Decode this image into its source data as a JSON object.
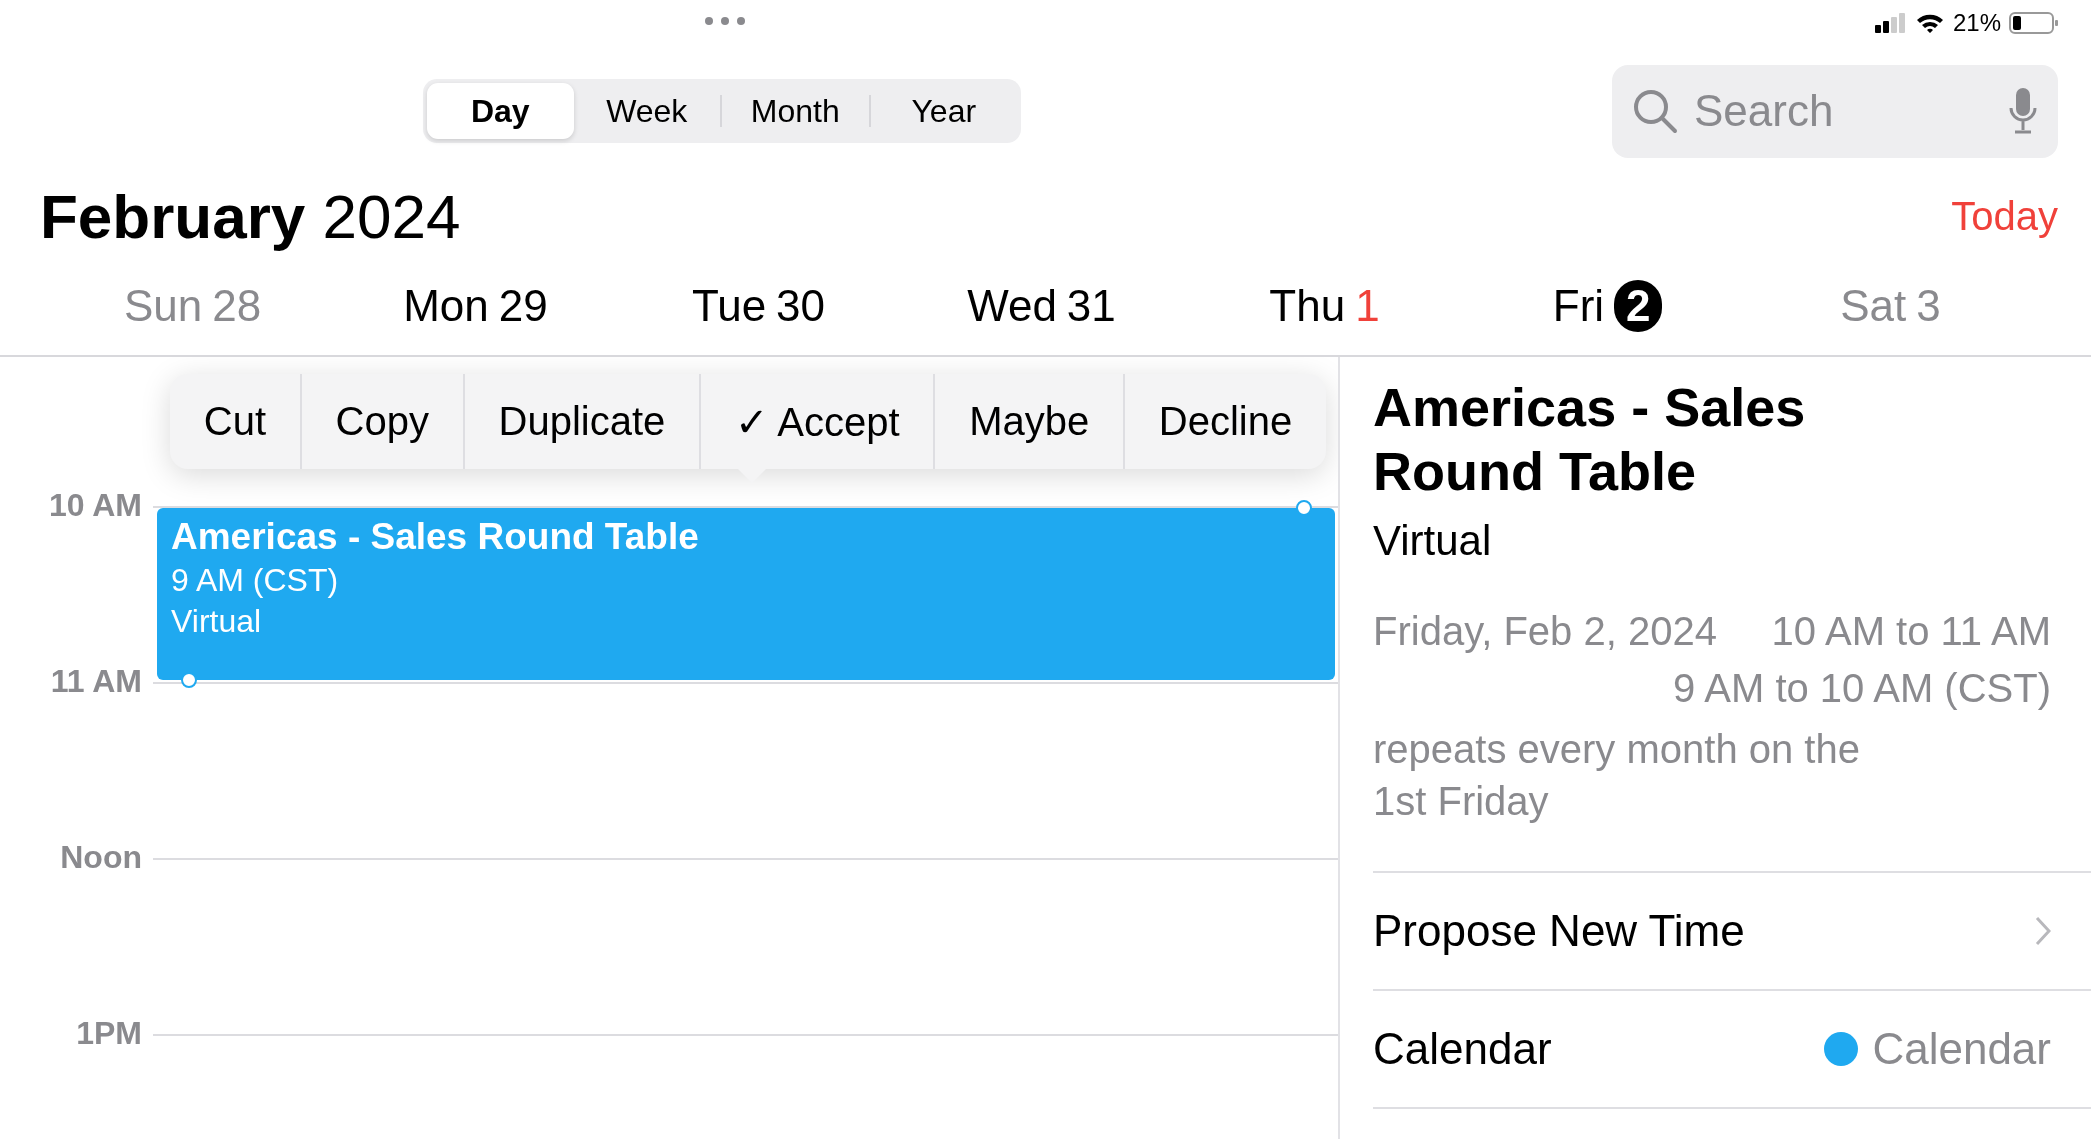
{
  "status_bar": {
    "battery": "21%"
  },
  "view_switcher": [
    {
      "label": "Day",
      "selected": true
    },
    {
      "label": "Week",
      "selected": false
    },
    {
      "label": "Month",
      "selected": false
    },
    {
      "label": "Year",
      "selected": false
    }
  ],
  "search": {
    "placeholder": "Search"
  },
  "header": {
    "month": "February",
    "year": "2024",
    "today_button": "Today"
  },
  "days": [
    {
      "weekday": "Sun",
      "number": "28",
      "weekend": true,
      "today": false,
      "selected": false
    },
    {
      "weekday": "Mon",
      "number": "29",
      "weekend": false,
      "today": false,
      "selected": false
    },
    {
      "weekday": "Tue",
      "number": "30",
      "weekend": false,
      "today": false,
      "selected": false
    },
    {
      "weekday": "Wed",
      "number": "31",
      "weekend": false,
      "today": false,
      "selected": false
    },
    {
      "weekday": "Thu",
      "number": "1",
      "weekend": false,
      "today": true,
      "selected": false
    },
    {
      "weekday": "Fri",
      "number": "2",
      "weekend": false,
      "today": false,
      "selected": true
    },
    {
      "weekday": "Sat",
      "number": "3",
      "weekend": true,
      "today": false,
      "selected": false
    }
  ],
  "hours": [
    "10 AM",
    "11 AM",
    "Noon",
    "1PM"
  ],
  "context_menu": [
    "Cut",
    "Copy",
    "Duplicate",
    "✓ Accept",
    "Maybe",
    "Decline"
  ],
  "event": {
    "title": "Americas - Sales Round Table",
    "time": "9 AM (CST)",
    "location": "Virtual",
    "color": "#1fa9f0"
  },
  "detail": {
    "title": "Americas - Sales Round Table",
    "location": "Virtual",
    "date": "Friday, Feb 2, 2024",
    "time": "10 AM to 11 AM",
    "alt_time": "9 AM to 10 AM (CST)",
    "recurrence": "repeats every month on the 1st Friday",
    "rows": [
      {
        "kind": "link",
        "label": "Propose New Time"
      },
      {
        "kind": "calendar",
        "label": "Calendar",
        "value": "Calendar",
        "color": "#1fa9f0"
      }
    ]
  }
}
